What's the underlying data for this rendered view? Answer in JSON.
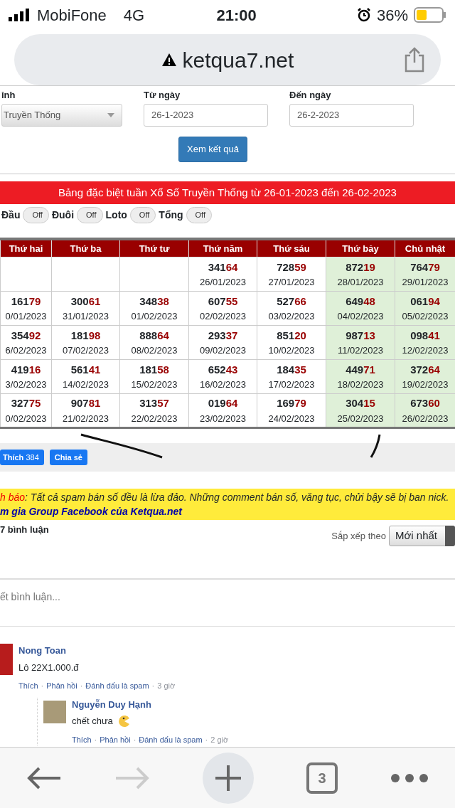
{
  "status_bar": {
    "carrier": "MobiFone",
    "network": "4G",
    "time": "21:00",
    "battery": "36%"
  },
  "address_bar": {
    "url": "ketqua7.net"
  },
  "form": {
    "fields": [
      {
        "label": "ỉnh",
        "kind": "select",
        "value": "Truyền Thống"
      },
      {
        "label": "Từ ngày",
        "kind": "input",
        "value": "26-1-2023"
      },
      {
        "label": "Đến ngày",
        "kind": "input",
        "value": "26-2-2023"
      }
    ],
    "submit": "Xem kết quả"
  },
  "banner": "Bảng đặc biệt tuần Xổ Số Truyền Thống từ 26-01-2023 đến 26-02-2023",
  "toggles": [
    {
      "label": "Đầu",
      "state_text": "Off",
      "on": false
    },
    {
      "label": "Đuôi",
      "state_text": "Off",
      "on": false
    },
    {
      "label": "Loto",
      "state_text": "Off",
      "on": false
    },
    {
      "label": "Tổng",
      "state_text": "Off",
      "on": false
    }
  ],
  "table": {
    "columns": [
      {
        "label": "Thứ hai",
        "weekend": false
      },
      {
        "label": "Thứ ba",
        "weekend": false
      },
      {
        "label": "Thứ tư",
        "weekend": false
      },
      {
        "label": "Thứ năm",
        "weekend": false
      },
      {
        "label": "Thứ sáu",
        "weekend": false
      },
      {
        "label": "Thứ bảy",
        "weekend": true
      },
      {
        "label": "Chủ nhật",
        "weekend": true
      }
    ],
    "rows": [
      [
        null,
        null,
        null,
        {
          "head": "341",
          "tail": "64",
          "date": "26/01/2023"
        },
        {
          "head": "728",
          "tail": "59",
          "date": "27/01/2023"
        },
        {
          "head": "872",
          "tail": "19",
          "date": "28/01/2023"
        },
        {
          "head": "764",
          "tail": "79",
          "date": "29/01/2023"
        }
      ],
      [
        {
          "head": "161",
          "tail": "79",
          "date": "0/01/2023"
        },
        {
          "head": "300",
          "tail": "61",
          "date": "31/01/2023"
        },
        {
          "head": "348",
          "tail": "38",
          "date": "01/02/2023"
        },
        {
          "head": "607",
          "tail": "55",
          "date": "02/02/2023"
        },
        {
          "head": "527",
          "tail": "66",
          "date": "03/02/2023"
        },
        {
          "head": "649",
          "tail": "48",
          "date": "04/02/2023"
        },
        {
          "head": "061",
          "tail": "94",
          "date": "05/02/2023"
        }
      ],
      [
        {
          "head": "354",
          "tail": "92",
          "date": "6/02/2023"
        },
        {
          "head": "181",
          "tail": "98",
          "date": "07/02/2023"
        },
        {
          "head": "888",
          "tail": "64",
          "date": "08/02/2023"
        },
        {
          "head": "293",
          "tail": "37",
          "date": "09/02/2023"
        },
        {
          "head": "851",
          "tail": "20",
          "date": "10/02/2023"
        },
        {
          "head": "987",
          "tail": "13",
          "date": "11/02/2023"
        },
        {
          "head": "098",
          "tail": "41",
          "date": "12/02/2023"
        }
      ],
      [
        {
          "head": "419",
          "tail": "16",
          "date": "3/02/2023"
        },
        {
          "head": "561",
          "tail": "41",
          "date": "14/02/2023"
        },
        {
          "head": "181",
          "tail": "58",
          "date": "15/02/2023"
        },
        {
          "head": "652",
          "tail": "43",
          "date": "16/02/2023"
        },
        {
          "head": "184",
          "tail": "35",
          "date": "17/02/2023"
        },
        {
          "head": "449",
          "tail": "71",
          "date": "18/02/2023"
        },
        {
          "head": "372",
          "tail": "64",
          "date": "19/02/2023"
        }
      ],
      [
        {
          "head": "327",
          "tail": "75",
          "date": "0/02/2023"
        },
        {
          "head": "907",
          "tail": "81",
          "date": "21/02/2023"
        },
        {
          "head": "313",
          "tail": "57",
          "date": "22/02/2023"
        },
        {
          "head": "019",
          "tail": "64",
          "date": "23/02/2023"
        },
        {
          "head": "169",
          "tail": "79",
          "date": "24/02/2023"
        },
        {
          "head": "304",
          "tail": "15",
          "date": "25/02/2023"
        },
        {
          "head": "673",
          "tail": "60",
          "date": "26/02/2023"
        }
      ]
    ]
  },
  "social": {
    "like_label": "Thích",
    "like_count": "384",
    "share": "Chia sẻ"
  },
  "notice": {
    "lead": "h báo",
    "text": ": Tất cả spam bán số đều là lừa đảo. Những comment bán số, văng tục, chửi bậy sẽ bị ban nick.",
    "link": "m gia Group Facebook của Ketqua.net"
  },
  "comments_header": {
    "count": "7 bình luận",
    "sort_label": "Sắp xếp theo",
    "sort_value": "Mới nhất"
  },
  "comment_box": {
    "placeholder": "ết bình luận..."
  },
  "comments": [
    {
      "author": "Nong Toan",
      "text": "Lô 22X1.000.đ",
      "emoji": false,
      "actions": [
        "Thích",
        "Phản hồi",
        "Đánh dấu là spam"
      ],
      "separator": "·",
      "time": "3 giờ",
      "children": [
        {
          "author": "Nguyễn Duy Hạnh",
          "text": "chết chưa",
          "emoji": true,
          "actions": [
            "Thích",
            "Phản hồi",
            "Đánh dấu là spam"
          ],
          "separator": "·",
          "time": "2 giờ"
        }
      ]
    }
  ],
  "toolbar": {
    "tab_count": "3",
    "forward_disabled": true
  }
}
